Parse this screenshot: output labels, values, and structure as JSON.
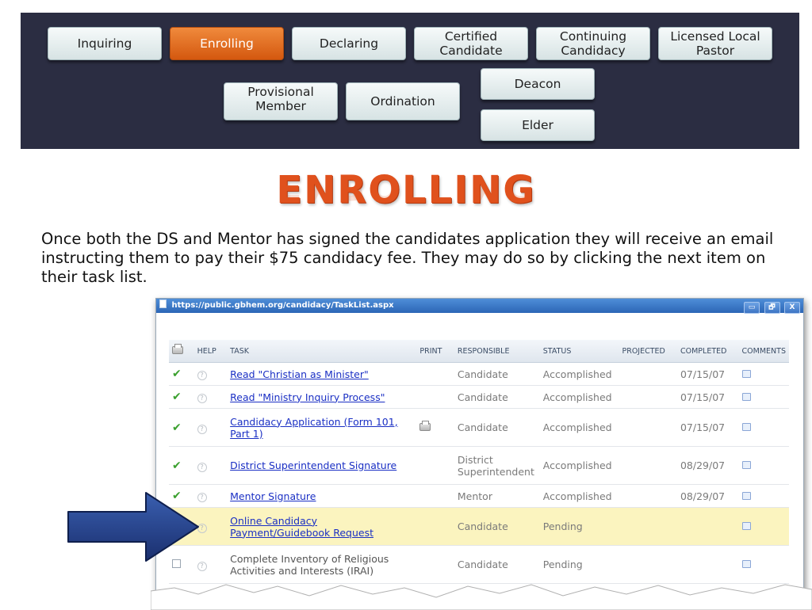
{
  "nav": {
    "steps": [
      {
        "label": "Inquiring"
      },
      {
        "label": "Enrolling"
      },
      {
        "label": "Declaring"
      },
      {
        "label": "Certified Candidate"
      },
      {
        "label": "Continuing Candidacy"
      },
      {
        "label": "Licensed Local Pastor"
      },
      {
        "label": "Provisional Member"
      },
      {
        "label": "Ordination"
      },
      {
        "label": "Deacon"
      },
      {
        "label": "Elder"
      }
    ],
    "active_color": "#e86d24"
  },
  "heading": "ENROLLING",
  "description": "Once both the DS and Mentor has signed the candidates application they will receive an email instructing them to pay their $75 candidacy fee. They may do so by clicking the next item on their task list.",
  "browser": {
    "url": "https://public.gbhem.org/candidacy/TaskList.aspx",
    "window_buttons": [
      "▭",
      "🗗",
      "X"
    ]
  },
  "table": {
    "headers": [
      "HELP",
      "TASK",
      "PRINT",
      "RESPONSIBLE",
      "STATUS",
      "PROJECTED",
      "COMPLETED",
      "COMMENTS"
    ],
    "rows": [
      {
        "task": "Read \"Christian as Minister\"",
        "responsible": "Candidate",
        "status": "Accomplished",
        "completed": "07/15/07",
        "checked": true,
        "link": true
      },
      {
        "task": "Read \"Ministry Inquiry Process\"",
        "responsible": "Candidate",
        "status": "Accomplished",
        "completed": "07/15/07",
        "checked": true,
        "link": true
      },
      {
        "task": "Candidacy Application (Form 101, Part 1)",
        "responsible": "Candidate",
        "status": "Accomplished",
        "completed": "07/15/07",
        "checked": true,
        "link": true,
        "printable": true
      },
      {
        "task": "District Superintendent Signature",
        "responsible": "District Superintendent",
        "status": "Accomplished",
        "completed": "08/29/07",
        "checked": true,
        "link": true
      },
      {
        "task": "Mentor Signature",
        "responsible": "Mentor",
        "status": "Accomplished",
        "completed": "08/29/07",
        "checked": true,
        "link": true
      },
      {
        "task": "Online Candidacy Payment/Guidebook Request",
        "responsible": "Candidate",
        "status": "Pending",
        "completed": "",
        "checked": false,
        "link": true,
        "highlight": true
      },
      {
        "task": "Complete Inventory of Religious Activities and Interests (IRAI)",
        "responsible": "Candidate",
        "status": "Pending",
        "completed": "",
        "checked": false,
        "link": false
      }
    ],
    "highlight_color": "#fbf4bf",
    "link_color": "#1a2fc4"
  },
  "arrow_color": "#1f3a7a"
}
